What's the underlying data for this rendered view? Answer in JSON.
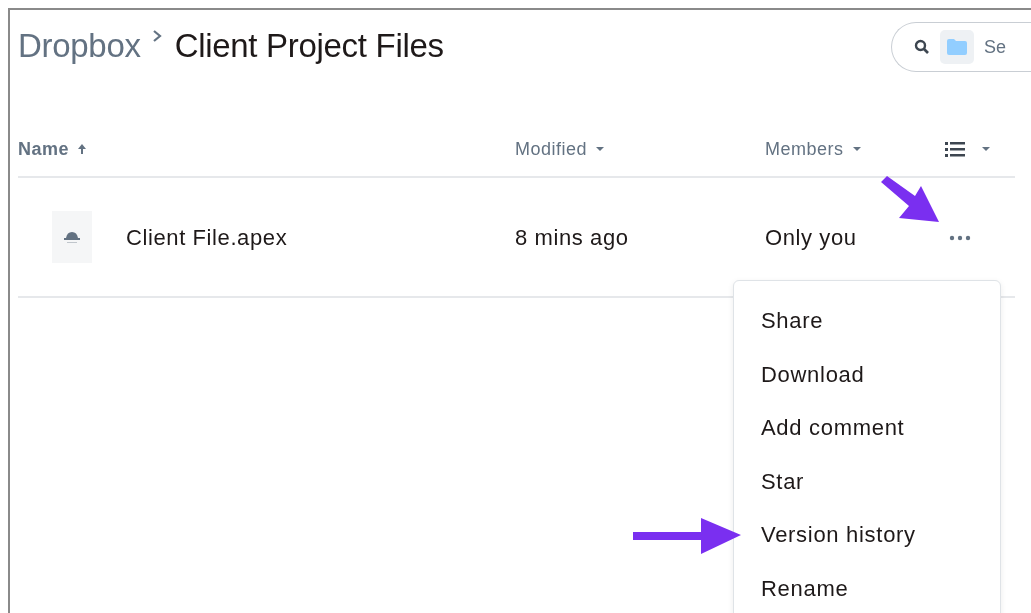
{
  "breadcrumb": [
    {
      "label": "Dropbox",
      "current": false
    },
    {
      "label": "Client Project Files",
      "current": true
    }
  ],
  "search": {
    "placeholder": "Se"
  },
  "table": {
    "columns": [
      {
        "label": "Name",
        "sorted": true
      },
      {
        "label": "Modified",
        "sorted": false
      },
      {
        "label": "Members",
        "sorted": false
      }
    ],
    "rows": [
      {
        "name": "Client File.apex",
        "modified": "8 mins ago",
        "members": "Only you",
        "actions_pointed": true
      }
    ]
  },
  "context_menu": {
    "items": [
      {
        "label": "Share",
        "pointed": false
      },
      {
        "label": "Download",
        "pointed": false
      },
      {
        "label": "Add comment",
        "pointed": false
      },
      {
        "label": "Star",
        "pointed": false
      },
      {
        "label": "Version history",
        "pointed": true
      },
      {
        "label": "Rename",
        "pointed": false
      }
    ]
  }
}
